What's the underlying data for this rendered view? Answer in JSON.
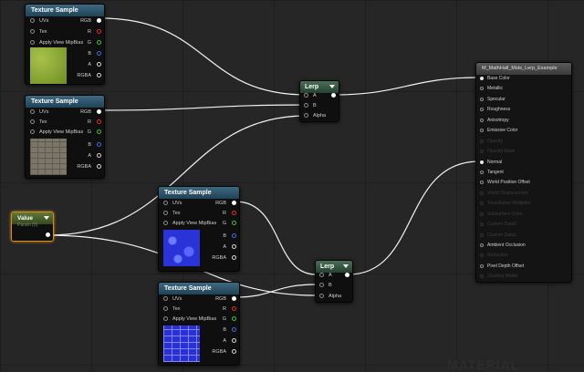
{
  "colors": {
    "pin_rgb": "#ffffff",
    "pin_r": "#e0312c",
    "pin_g": "#3fc43f",
    "pin_b": "#3f6fe0",
    "pin_a": "#d8d8d8",
    "wire": "#f2f2f2",
    "selection_outline": "#d38b1c"
  },
  "texture_nodes": [
    {
      "title": "Texture Sample",
      "inputs": [
        "UVs",
        "Tex",
        "Apply View MipBias"
      ],
      "outputs": [
        "RGB",
        "R",
        "G",
        "B",
        "A",
        "RGBA"
      ],
      "preview": "grass-texture"
    },
    {
      "title": "Texture Sample",
      "inputs": [
        "UVs",
        "Tex",
        "Apply View MipBias"
      ],
      "outputs": [
        "RGB",
        "R",
        "G",
        "B",
        "A",
        "RGBA"
      ],
      "preview": "cobblestone-texture"
    },
    {
      "title": "Texture Sample",
      "inputs": [
        "UVs",
        "Tex",
        "Apply View MipBias"
      ],
      "outputs": [
        "RGB",
        "R",
        "G",
        "B",
        "A",
        "RGBA"
      ],
      "preview": "cobblestone-normal-map"
    },
    {
      "title": "Texture Sample",
      "inputs": [
        "UVs",
        "Tex",
        "Apply View MipBias"
      ],
      "outputs": [
        "RGB",
        "R",
        "G",
        "B",
        "A",
        "RGBA"
      ],
      "preview": "tiles-normal-map"
    }
  ],
  "lerp_nodes": [
    {
      "title": "Lerp",
      "inputs": [
        "A",
        "B",
        "Alpha"
      ]
    },
    {
      "title": "Lerp",
      "inputs": [
        "A",
        "B",
        "Alpha"
      ]
    }
  ],
  "value_node": {
    "title": "Value",
    "subtitle": "Param (0)"
  },
  "material_node": {
    "title": "M_MathHall_Msts_Lerp_Example",
    "pins": [
      {
        "label": "Base Color",
        "state": "active"
      },
      {
        "label": "Metallic",
        "state": "enabled"
      },
      {
        "label": "Specular",
        "state": "enabled"
      },
      {
        "label": "Roughness",
        "state": "enabled"
      },
      {
        "label": "Anisotropy",
        "state": "enabled"
      },
      {
        "label": "Emissive Color",
        "state": "enabled"
      },
      {
        "label": "Opacity",
        "state": "disabled"
      },
      {
        "label": "Opacity Mask",
        "state": "disabled"
      },
      {
        "label": "Normal",
        "state": "active"
      },
      {
        "label": "Tangent",
        "state": "enabled"
      },
      {
        "label": "World Position Offset",
        "state": "enabled"
      },
      {
        "label": "World Displacement",
        "state": "disabled"
      },
      {
        "label": "Tessellation Multiplier",
        "state": "disabled"
      },
      {
        "label": "Subsurface Color",
        "state": "disabled"
      },
      {
        "label": "Custom Data0",
        "state": "disabled"
      },
      {
        "label": "Custom Data1",
        "state": "disabled"
      },
      {
        "label": "Ambient Occlusion",
        "state": "enabled"
      },
      {
        "label": "Refraction",
        "state": "disabled"
      },
      {
        "label": "Pixel Depth Offset",
        "state": "enabled"
      },
      {
        "label": "Shading Model",
        "state": "disabled"
      }
    ]
  },
  "watermark": "MATERIAL"
}
